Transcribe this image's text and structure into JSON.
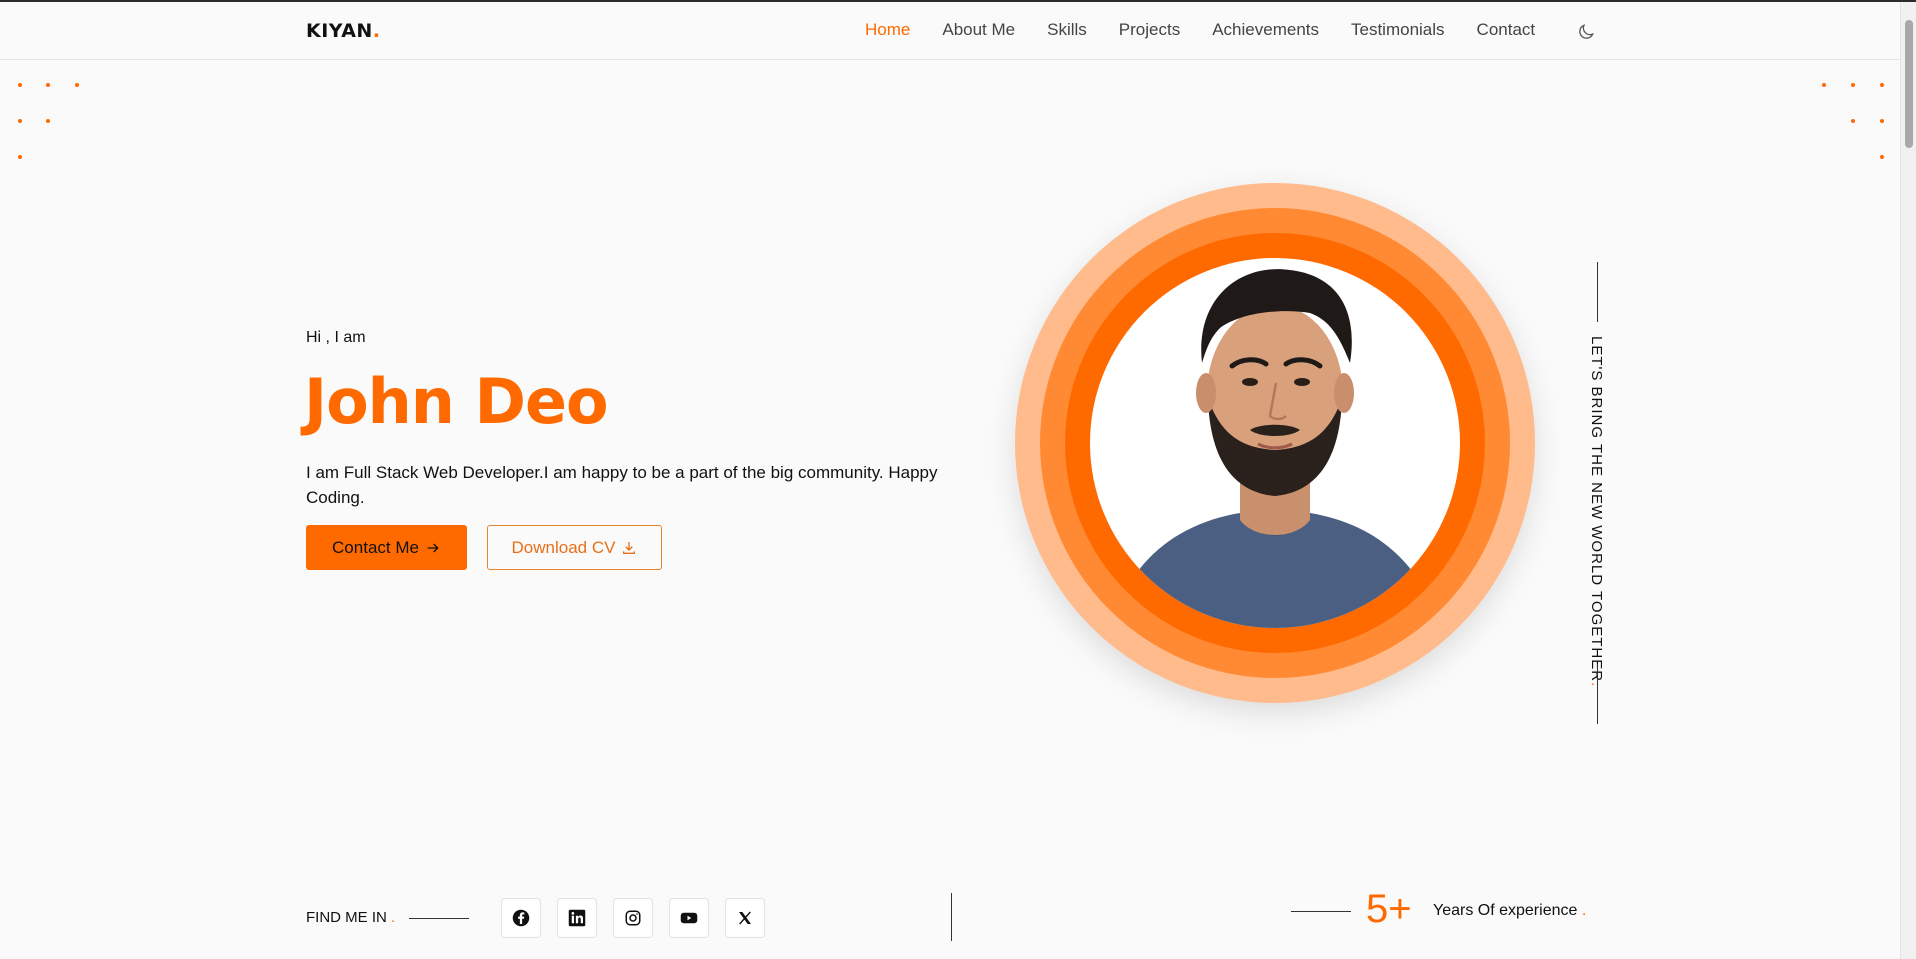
{
  "nav": {
    "logo": "KIYAN",
    "logo_dot": ".",
    "items": [
      {
        "label": "Home",
        "active": true
      },
      {
        "label": "About Me"
      },
      {
        "label": "Skills"
      },
      {
        "label": "Projects"
      },
      {
        "label": "Achievements"
      },
      {
        "label": "Testimonials"
      },
      {
        "label": "Contact"
      }
    ],
    "theme_icon": "moon-icon"
  },
  "hero": {
    "greeting": "Hi , I am",
    "name": "John Deo",
    "description": "I am Full Stack Web Developer.I am happy to be a part of the big community. Happy Coding.",
    "contact_button": "Contact Me",
    "contact_icon": "arrow-right-icon",
    "download_button": "Download CV",
    "download_icon": "download-icon"
  },
  "slogan": {
    "text": "LET'S BRING THE NEW WORLD TOGETHER",
    "dot": "."
  },
  "footer": {
    "find_me": "FIND ME IN",
    "find_me_dot": ".",
    "socials": [
      "facebook-icon",
      "linkedin-icon",
      "instagram-icon",
      "youtube-icon",
      "x-icon"
    ],
    "years_value": "5+",
    "years_label": "Years Of experience",
    "years_dot": "."
  },
  "colors": {
    "accent": "#ff6a00",
    "ring_light": "#ffbb8c",
    "ring_mid": "#ff8a33"
  }
}
